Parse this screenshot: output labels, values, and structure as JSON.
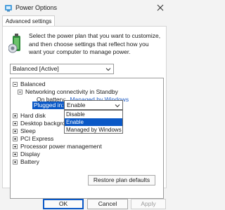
{
  "window": {
    "title": "Power Options"
  },
  "tabs": [
    {
      "label": "Advanced settings"
    }
  ],
  "intro_text": "Select the power plan that you want to customize, and then choose settings that reflect how you want your computer to manage power.",
  "plan_select": {
    "value": "Balanced [Active]"
  },
  "tree": {
    "balanced": "Balanced",
    "networking": "Networking connectivity in Standby",
    "on_battery_label": "On battery:",
    "on_battery_value": "Managed by Windows",
    "plugged_in_label": "Plugged in:",
    "plugged_in_value": "Enable",
    "dropdown_options": [
      "Disable",
      "Enable",
      "Managed by Windows"
    ],
    "items": [
      "Hard disk",
      "Desktop background settings",
      "Sleep",
      "PCI Express",
      "Processor power management",
      "Display",
      "Battery"
    ]
  },
  "buttons": {
    "restore": "Restore plan defaults",
    "ok": "OK",
    "cancel": "Cancel",
    "apply": "Apply"
  },
  "colors": {
    "accent": "#0a58c6",
    "link": "#1f5cc4"
  }
}
